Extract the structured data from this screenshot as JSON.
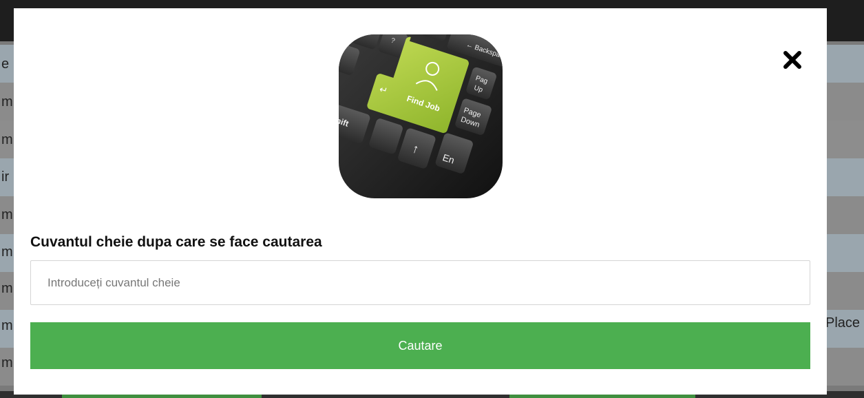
{
  "background": {
    "row_letters": [
      "e",
      "m",
      "m",
      "ir",
      "m",
      "m",
      "m",
      "m",
      "m"
    ],
    "right_text": "Place"
  },
  "modal": {
    "close_icon": "close-icon",
    "hero_image": {
      "icon": "find-job-keyboard-image",
      "keys": {
        "find_job": "Find Job",
        "backspace": "Backspace",
        "page_up": "Page Up",
        "page_down": "Page Down",
        "shift": "Shift",
        "end": "End"
      }
    },
    "keyword_label": "Cuvantul cheie dupa care se face cautarea",
    "keyword_input": {
      "value": "",
      "placeholder": "Introduceți cuvantul cheie"
    },
    "search_button_label": "Cautare"
  },
  "colors": {
    "accent_green": "#4caf50",
    "overlay_gray": "#8b8b8b",
    "key_green": "#a4c63a"
  }
}
